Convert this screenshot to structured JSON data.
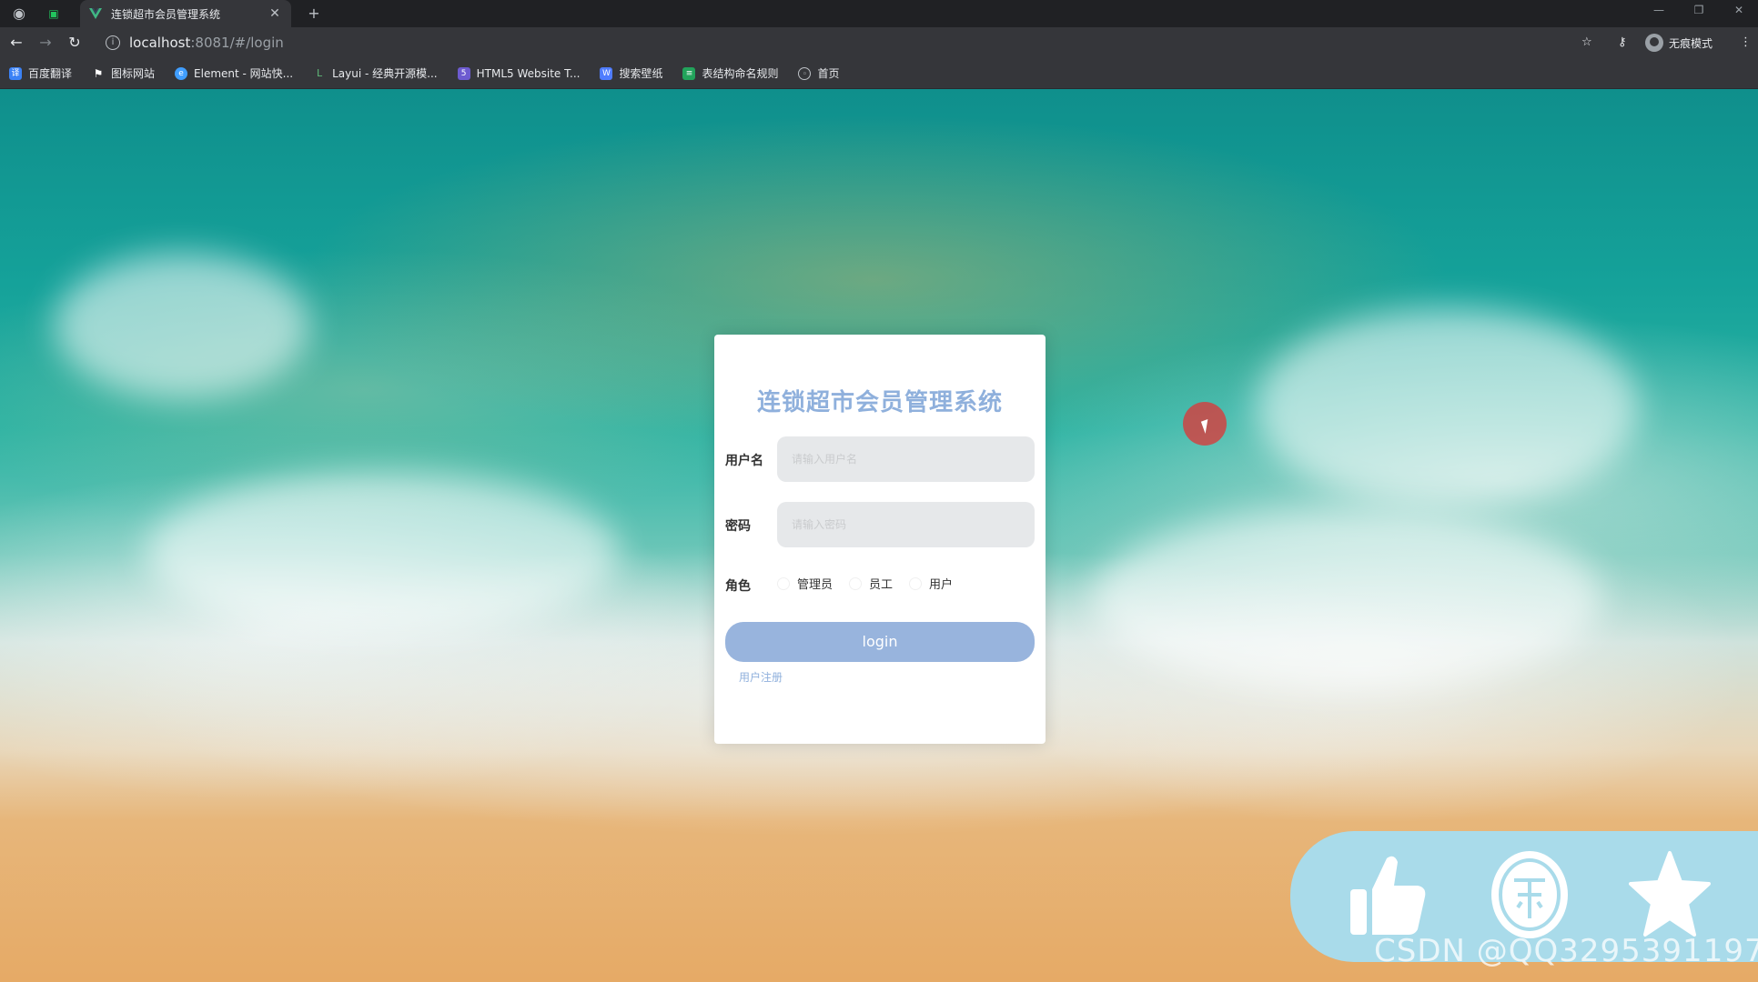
{
  "browser": {
    "tab_title": "连锁超市会员管理系统",
    "url_host": "localhost",
    "url_rest": ":8081/#/login",
    "profile_label": "无痕模式",
    "bookmarks": [
      {
        "label": "百度翻译",
        "color": "#3b82f6"
      },
      {
        "label": "图标网站",
        "color": "#ffffff"
      },
      {
        "label": "Element - 网站快...",
        "color": "#409eff"
      },
      {
        "label": "Layui - 经典开源模...",
        "color": "#5fb878"
      },
      {
        "label": "HTML5 Website T...",
        "color": "#6d5bd0"
      },
      {
        "label": "搜索壁纸",
        "color": "#4f7cff"
      },
      {
        "label": "表结构命名规则",
        "color": "#22a35b"
      },
      {
        "label": "首页",
        "color": "#9aa0a6"
      }
    ]
  },
  "login": {
    "title": "连锁超市会员管理系统",
    "username_label": "用户名",
    "username_placeholder": "请输入用户名",
    "password_label": "密码",
    "password_placeholder": "请输入密码",
    "role_label": "角色",
    "roles": [
      "管理员",
      "员工",
      "用户"
    ],
    "login_button": "login",
    "register_link": "用户注册"
  },
  "overlay": {
    "watermark": "CSDN @QQ3295391197"
  }
}
